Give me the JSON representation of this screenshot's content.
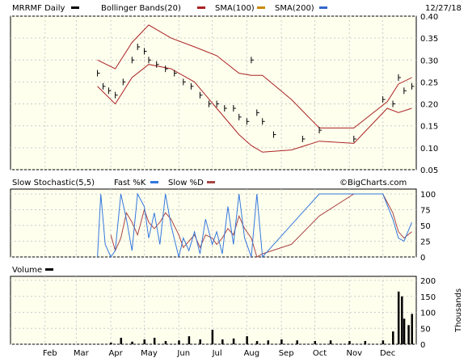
{
  "header": {
    "ticker_label": "MRRMF Daily",
    "bollinger_label": "Bollinger Bands(20)",
    "sma100_label": "SMA(100)",
    "sma200_label": "SMA(200)",
    "date_label": "12/27/18"
  },
  "stoch_header": {
    "title": "Slow Stochastic(5,5)",
    "fastk_label": "Fast %K",
    "slowd_label": "Slow %D",
    "watermark": "©BigCharts.com"
  },
  "volume_header": {
    "title": "Volume",
    "units_label": "Thousands"
  },
  "colors": {
    "panel_bg": "#ffffee",
    "bollinger": "#aa2222",
    "sma100": "#aa2222",
    "sma200": "#cc8800",
    "sma_extra": "#3366cc",
    "fastk": "#3377dd",
    "slowd": "#aa4444",
    "legend_black": "#000000"
  },
  "chart_data": [
    {
      "type": "line",
      "panel": "price",
      "y_ticks": [
        "0.40",
        "0.35",
        "0.30",
        "0.25",
        "0.20",
        "0.15",
        "0.10",
        "0.05"
      ],
      "ylim": [
        0.05,
        0.4
      ],
      "grid": true,
      "bollinger_upper": {
        "x": [
          "Mar 20",
          "Apr 5",
          "Apr 20",
          "May 5",
          "May 25",
          "Jun 15",
          "Jul 5",
          "Jul 25",
          "Aug 5",
          "Aug 15",
          "Sep 10",
          "Oct 5",
          "Nov 5",
          "Dec 5",
          "Dec 15",
          "Dec 27"
        ],
        "y": [
          0.3,
          0.28,
          0.34,
          0.38,
          0.35,
          0.33,
          0.31,
          0.27,
          0.265,
          0.265,
          0.21,
          0.145,
          0.145,
          0.205,
          0.245,
          0.26
        ]
      },
      "bollinger_lower": {
        "x": [
          "Mar 20",
          "Apr 5",
          "Apr 20",
          "May 5",
          "May 25",
          "Jun 15",
          "Jul 5",
          "Jul 25",
          "Aug 5",
          "Aug 15",
          "Sep 10",
          "Oct 5",
          "Nov 5",
          "Dec 5",
          "Dec 15",
          "Dec 27"
        ],
        "y": [
          0.24,
          0.2,
          0.26,
          0.29,
          0.28,
          0.25,
          0.19,
          0.13,
          0.105,
          0.09,
          0.095,
          0.115,
          0.11,
          0.19,
          0.18,
          0.19
        ]
      },
      "price_points": {
        "x": [
          "Mar 20",
          "Mar 25",
          "Mar 30",
          "Apr 5",
          "Apr 12",
          "Apr 20",
          "Apr 25",
          "May 1",
          "May 5",
          "May 12",
          "May 20",
          "May 28",
          "Jun 5",
          "Jun 12",
          "Jun 20",
          "Jun 28",
          "Jul 5",
          "Jul 12",
          "Jul 20",
          "Jul 25",
          "Aug 1",
          "Aug 5",
          "Aug 10",
          "Aug 15",
          "Aug 25",
          "Sep 20",
          "Oct 5",
          "Nov 5",
          "Dec 1",
          "Dec 10",
          "Dec 15",
          "Dec 20",
          "Dec 27"
        ],
        "y": [
          0.27,
          0.24,
          0.23,
          0.22,
          0.25,
          0.3,
          0.33,
          0.32,
          0.3,
          0.29,
          0.28,
          0.27,
          0.25,
          0.24,
          0.22,
          0.2,
          0.2,
          0.19,
          0.19,
          0.17,
          0.16,
          0.3,
          0.18,
          0.16,
          0.13,
          0.12,
          0.14,
          0.12,
          0.21,
          0.2,
          0.26,
          0.23,
          0.24
        ]
      }
    },
    {
      "type": "line",
      "panel": "stochastic",
      "y_ticks": [
        "100",
        "75",
        "50",
        "25",
        "0"
      ],
      "ylim": [
        0,
        100
      ],
      "grid": true,
      "series": [
        {
          "name": "Fast %K",
          "x": [
            "Mar 20",
            "Mar 23",
            "Mar 27",
            "Apr 1",
            "Apr 5",
            "Apr 10",
            "Apr 15",
            "Apr 20",
            "Apr 25",
            "May 1",
            "May 5",
            "May 10",
            "May 15",
            "May 20",
            "May 25",
            "Jun 1",
            "Jun 5",
            "Jun 10",
            "Jun 15",
            "Jun 20",
            "Jun 25",
            "Jul 1",
            "Jul 5",
            "Jul 10",
            "Jul 15",
            "Jul 20",
            "Jul 25",
            "Jul 30",
            "Aug 5",
            "Aug 10",
            "Aug 15",
            "Oct 5",
            "Nov 5",
            "Dec 1",
            "Dec 10",
            "Dec 15",
            "Dec 20",
            "Dec 27"
          ],
          "y": [
            0,
            100,
            20,
            0,
            10,
            100,
            60,
            10,
            100,
            80,
            30,
            70,
            20,
            100,
            50,
            0,
            30,
            10,
            40,
            5,
            60,
            20,
            40,
            5,
            80,
            20,
            100,
            30,
            0,
            100,
            0,
            100,
            100,
            100,
            60,
            30,
            25,
            55
          ]
        },
        {
          "name": "Slow %D",
          "x": [
            "Apr 1",
            "Apr 5",
            "Apr 10",
            "Apr 15",
            "Apr 20",
            "Apr 25",
            "May 1",
            "May 5",
            "May 10",
            "May 15",
            "May 20",
            "May 25",
            "Jun 1",
            "Jun 5",
            "Jun 10",
            "Jun 15",
            "Jun 20",
            "Jun 25",
            "Jul 1",
            "Jul 5",
            "Jul 10",
            "Jul 15",
            "Jul 20",
            "Jul 25",
            "Jul 30",
            "Aug 5",
            "Aug 10",
            "Aug 15",
            "Sep 10",
            "Oct 5",
            "Nov 5",
            "Dec 1",
            "Dec 10",
            "Dec 15",
            "Dec 20",
            "Dec 27"
          ],
          "y": [
            35,
            10,
            30,
            70,
            55,
            35,
            75,
            55,
            45,
            55,
            70,
            60,
            35,
            15,
            25,
            35,
            15,
            35,
            30,
            20,
            30,
            45,
            35,
            65,
            45,
            30,
            0,
            5,
            20,
            65,
            100,
            100,
            70,
            40,
            30,
            40
          ]
        }
      ]
    },
    {
      "type": "bar",
      "panel": "volume",
      "y_ticks": [
        "200",
        "150",
        "100",
        "50",
        "0"
      ],
      "ylim": [
        0,
        200
      ],
      "x_ticks": [
        "Feb",
        "Mar",
        "Apr",
        "May",
        "Jun",
        "Jul",
        "Aug",
        "Sep",
        "Oct",
        "Nov",
        "Dec"
      ],
      "categories": [
        "Apr 1",
        "Apr 10",
        "Apr 20",
        "May 1",
        "May 10",
        "May 20",
        "Jun 1",
        "Jun 10",
        "Jun 20",
        "Jul 1",
        "Jul 10",
        "Jul 20",
        "Aug 1",
        "Aug 10",
        "Aug 20",
        "Sep 1",
        "Sep 15",
        "Oct 1",
        "Oct 15",
        "Nov 1",
        "Nov 15",
        "Dec 1",
        "Dec 10",
        "Dec 15",
        "Dec 18",
        "Dec 20",
        "Dec 24",
        "Dec 27"
      ],
      "values": [
        5,
        20,
        8,
        15,
        20,
        10,
        12,
        25,
        15,
        45,
        15,
        18,
        25,
        10,
        12,
        15,
        12,
        10,
        12,
        10,
        10,
        12,
        40,
        165,
        150,
        80,
        60,
        95
      ]
    }
  ]
}
